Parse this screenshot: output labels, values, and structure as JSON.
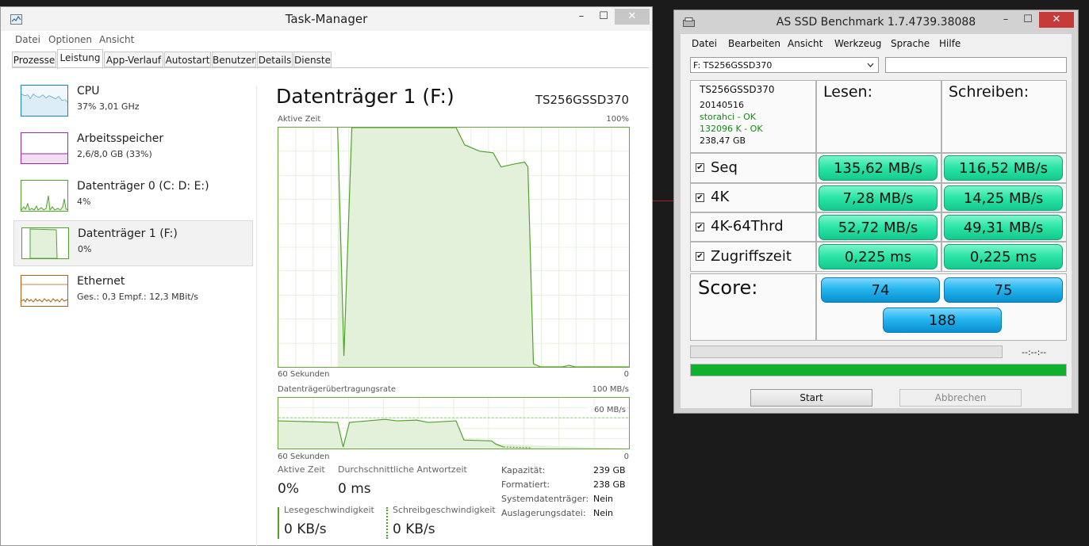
{
  "task_manager": {
    "title": "Task-Manager",
    "menu": [
      "Datei",
      "Optionen",
      "Ansicht"
    ],
    "tabs": [
      "Prozesse",
      "Leistung",
      "App-Verlauf",
      "Autostart",
      "Benutzer",
      "Details",
      "Dienste"
    ],
    "active_tab": "Leistung",
    "window_buttons": {
      "minimize": "–",
      "maximize": "☐",
      "close": "✕"
    },
    "perf_items": [
      {
        "title": "CPU",
        "sub": "37% 3,01 GHz",
        "color": "#1783c7"
      },
      {
        "title": "Arbeitsspeicher",
        "sub": "2,6/8,0 GB (33%)",
        "color": "#9b2aa6"
      },
      {
        "title": "Datenträger 0 (C: D: E:)",
        "sub": "4%",
        "color": "#4fa32a"
      },
      {
        "title": "Datenträger 1 (F:)",
        "sub": "0%",
        "color": "#4fa32a"
      },
      {
        "title": "Ethernet",
        "sub_label1": "Ges.:",
        "sub_val1": "0,3",
        "sub_label2": "Empf.:",
        "sub_val2": "12,3 MBit/s",
        "color": "#b25d11"
      }
    ],
    "detail": {
      "title": "Datenträger 1 (F:)",
      "model": "TS256GSSD370",
      "graph1": {
        "label": "Aktive Zeit",
        "max": "100%",
        "xlabel": "60 Sekunden",
        "min": "0"
      },
      "graph2": {
        "label": "Datenträgerübertragungsrate",
        "max": "100 MB/s",
        "line_label": "60 MB/s",
        "xlabel": "60 Sekunden",
        "min": "0"
      },
      "stats": {
        "active_label": "Aktive Zeit",
        "active_val": "0%",
        "resp_label": "Durchschnittliche Antwortzeit",
        "resp_val": "0 ms",
        "read_label": "Lesegeschwindigkeit",
        "read_val": "0 KB/s",
        "write_label": "Schreibgeschwindigkeit",
        "write_val": "0 KB/s"
      },
      "props": [
        {
          "k": "Kapazität:",
          "v": "239 GB"
        },
        {
          "k": "Formatiert:",
          "v": "238 GB"
        },
        {
          "k": "Systemdatenträger:",
          "v": "Nein"
        },
        {
          "k": "Auslagerungsdatei:",
          "v": "Nein"
        }
      ]
    }
  },
  "as_ssd": {
    "title": "AS SSD Benchmark 1.7.4739.38088",
    "window_buttons": {
      "minimize": "–",
      "maximize": "☐",
      "close": "✕"
    },
    "menu": [
      "Datei",
      "Bearbeiten",
      "Ansicht",
      "Werkzeug",
      "Sprache",
      "Hilfe"
    ],
    "drive_select": "F: TS256GSSD370",
    "drive_info": {
      "model": "TS256GSSD370",
      "firmware": "20140516",
      "driver": "storahci - OK",
      "alignment": "132096 K - OK",
      "size": "238,47 GB"
    },
    "col_read": "Lesen:",
    "col_write": "Schreiben:",
    "rows": [
      {
        "label": "Seq",
        "read": "135,62 MB/s",
        "write": "116,52 MB/s"
      },
      {
        "label": "4K",
        "read": "7,28 MB/s",
        "write": "14,25 MB/s"
      },
      {
        "label": "4K-64Thrd",
        "read": "52,72 MB/s",
        "write": "49,31 MB/s"
      },
      {
        "label": "Zugriffszeit",
        "read": "0,225 ms",
        "write": "0,225 ms"
      }
    ],
    "checkmark": "✔",
    "score_label": "Score:",
    "score_read": "74",
    "score_write": "75",
    "score_total": "188",
    "time": "--:--:--",
    "progress_fraction": 1.0,
    "start_button": "Start",
    "cancel_button": "Abbrechen",
    "colors": {
      "progress": "#0fb02e",
      "pill_green": "#2ee6a8",
      "pill_blue": "#25b6ef"
    }
  }
}
